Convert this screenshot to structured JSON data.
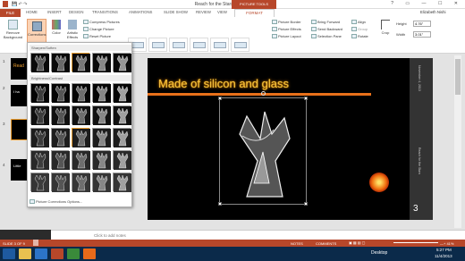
{
  "window": {
    "title": "Reach for the Stars EAN - PowerPoint",
    "context_tools": "PICTURE TOOLS",
    "controls": "? ▭ — ☐ ✕"
  },
  "tabs": {
    "file": "FILE",
    "items": [
      "HOME",
      "INSERT",
      "DESIGN",
      "TRANSITIONS",
      "ANIMATIONS",
      "SLIDE SHOW",
      "REVIEW",
      "VIEW"
    ],
    "format": "FORMAT",
    "user": "Elizabeth Nishi"
  },
  "ribbon": {
    "remove_background": "Remove Background",
    "corrections": "Corrections",
    "color": "Color",
    "artistic_effects": "Artistic Effects",
    "compress": "Compress Pictures",
    "change": "Change Picture",
    "reset": "Reset Picture",
    "picture_styles_label": "Picture Styles",
    "picture_border": "Picture Border",
    "picture_effects": "Picture Effects",
    "picture_layout": "Picture Layout",
    "bring_forward": "Bring Forward",
    "send_backward": "Send Backward",
    "selection_pane": "Selection Pane",
    "align": "Align",
    "group": "Group",
    "rotate": "Rotate",
    "arrange_label": "Arrange",
    "crop": "Crop",
    "height_label": "Height",
    "height_value": "4.76\"",
    "width_label": "Width",
    "width_value": "3.01\"",
    "size_label": "Size"
  },
  "dropdown": {
    "sharpen_header": "Sharpen/Soften",
    "brightness_header": "Brightness/Contrast",
    "options_link": "Picture Corrections Options..."
  },
  "slide": {
    "title": "Made of silicon and glass",
    "date": "November 4, 2013",
    "footer": "Reach for the Stars",
    "number": "3"
  },
  "thumbnails": {
    "numbers": [
      "1",
      "2",
      "3",
      "4"
    ],
    "snippets": [
      "Read",
      "I ha",
      "",
      "Little"
    ]
  },
  "notes_placeholder": "Click to add notes",
  "status": {
    "slide_info": "SLIDE 3 OF 9",
    "notes": "NOTES",
    "comments": "COMMENTS",
    "zoom": "—+ 41%"
  },
  "taskbar": {
    "desktop": "Desktop",
    "time": "5:27 PM",
    "date": "11/4/2013"
  },
  "colors": {
    "accent": "#b7472a",
    "title_glow": "#f0a030",
    "slide_number_bg": "#3a3a3a"
  }
}
